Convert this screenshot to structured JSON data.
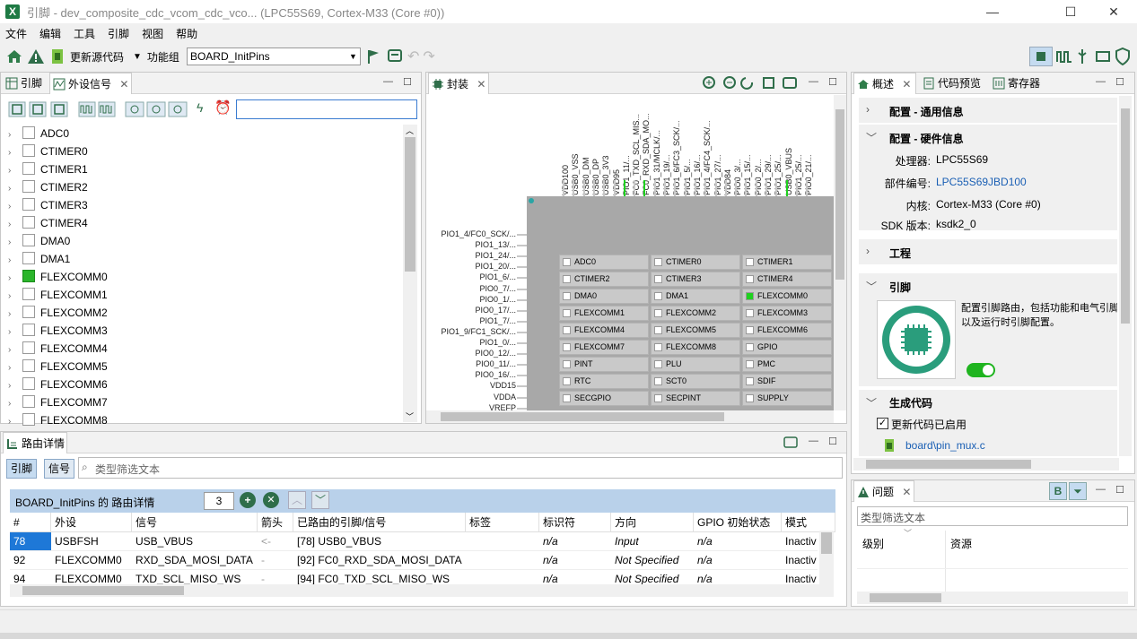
{
  "window": {
    "title": "引脚 - dev_composite_cdc_vcom_cdc_vco... (LPC55S69, Cortex-M33 (Core #0))",
    "minimize": "—",
    "maximize": "☐",
    "close": "✕"
  },
  "menu": [
    "文件",
    "编辑",
    "工具",
    "引脚",
    "视图",
    "帮助"
  ],
  "toolbar": {
    "update_code": "更新源代码",
    "function_group_label": "功能组",
    "function_group_value": "BOARD_InitPins"
  },
  "left_panel": {
    "tabs": [
      "引脚",
      "外设信号"
    ],
    "search_value": "",
    "items": [
      {
        "label": "ADC0",
        "checked": false
      },
      {
        "label": "CTIMER0",
        "checked": false
      },
      {
        "label": "CTIMER1",
        "checked": false
      },
      {
        "label": "CTIMER2",
        "checked": false
      },
      {
        "label": "CTIMER3",
        "checked": false
      },
      {
        "label": "CTIMER4",
        "checked": false
      },
      {
        "label": "DMA0",
        "checked": false
      },
      {
        "label": "DMA1",
        "checked": false
      },
      {
        "label": "FLEXCOMM0",
        "checked": true
      },
      {
        "label": "FLEXCOMM1",
        "checked": false
      },
      {
        "label": "FLEXCOMM2",
        "checked": false
      },
      {
        "label": "FLEXCOMM3",
        "checked": false
      },
      {
        "label": "FLEXCOMM4",
        "checked": false
      },
      {
        "label": "FLEXCOMM5",
        "checked": false
      },
      {
        "label": "FLEXCOMM6",
        "checked": false
      },
      {
        "label": "FLEXCOMM7",
        "checked": false
      },
      {
        "label": "FLEXCOMM8",
        "checked": false
      }
    ]
  },
  "package_panel": {
    "tab": "封装",
    "top_pins": [
      "VDD100",
      "USB0_VSS",
      "USB0_DM",
      "USB0_DP",
      "USB0_3V3",
      "VDD95",
      "PIO1_11/...",
      "FC0_TXD_SCL_MIS...",
      "FC0_RXD_SDA_MO...",
      "PIO1_31/MCLK/...",
      "PIO1_19/...",
      "PIO1_6/FC3_SCK/...",
      "PIO1_5/...",
      "PIO1_16/...",
      "PIO1_4/FC4_SCK/...",
      "PIO1_27/...",
      "VDD84",
      "PIO0_3/...",
      "PIO1_15/...",
      "PIO0_2/...",
      "PIO1_29/...",
      "PIO1_25/...",
      "USB0_VBUS",
      "PIO1_25/...",
      "PIO0_21/..."
    ],
    "left_pins": [
      "PIO1_4/FC0_SCK/...",
      "PIO1_13/...",
      "PIO1_24/...",
      "PIO1_20/...",
      "PIO1_6/...",
      "PIO0_7/...",
      "PIO0_1/...",
      "PIO0_17/...",
      "PIO1_7/...",
      "PIO1_9/FC1_SCK/...",
      "PIO1_0/...",
      "PIO0_12/...",
      "PIO0_11/...",
      "PIO0_16/...",
      "VDD15",
      "VDDA",
      "VREFP"
    ],
    "cells": [
      {
        "label": "ADC0",
        "on": false
      },
      {
        "label": "CTIMER0",
        "on": false
      },
      {
        "label": "CTIMER1",
        "on": false
      },
      {
        "label": "CTIMER2",
        "on": false
      },
      {
        "label": "CTIMER3",
        "on": false
      },
      {
        "label": "CTIMER4",
        "on": false
      },
      {
        "label": "DMA0",
        "on": false
      },
      {
        "label": "DMA1",
        "on": false
      },
      {
        "label": "FLEXCOMM0",
        "on": true
      },
      {
        "label": "FLEXCOMM1",
        "on": false
      },
      {
        "label": "FLEXCOMM2",
        "on": false
      },
      {
        "label": "FLEXCOMM3",
        "on": false
      },
      {
        "label": "FLEXCOMM4",
        "on": false
      },
      {
        "label": "FLEXCOMM5",
        "on": false
      },
      {
        "label": "FLEXCOMM6",
        "on": false
      },
      {
        "label": "FLEXCOMM7",
        "on": false
      },
      {
        "label": "FLEXCOMM8",
        "on": false
      },
      {
        "label": "GPIO",
        "on": false
      },
      {
        "label": "PINT",
        "on": false
      },
      {
        "label": "PLU",
        "on": false
      },
      {
        "label": "PMC",
        "on": false
      },
      {
        "label": "RTC",
        "on": false
      },
      {
        "label": "SCT0",
        "on": false
      },
      {
        "label": "SDIF",
        "on": false
      },
      {
        "label": "SECGPIO",
        "on": false
      },
      {
        "label": "SECPINT",
        "on": false
      },
      {
        "label": "SUPPLY",
        "on": false
      }
    ]
  },
  "overview_panel": {
    "tabs": [
      "概述",
      "代码预览",
      "寄存器"
    ],
    "config_general": "配置 - 通用信息",
    "config_hw": "配置 - 硬件信息",
    "processor_label": "处理器:",
    "processor_value": "LPC55S69",
    "part_label": "部件编号:",
    "part_value": "LPC55S69JBD100",
    "core_label": "内核:",
    "core_value": "Cortex-M33 (Core #0)",
    "sdk_label": "SDK 版本:",
    "sdk_value": "ksdk2_0",
    "project": "工程",
    "pins": "引脚",
    "pins_desc_1": "配置引脚路由，包括功能和电气引脚",
    "pins_desc_2": "以及运行时引脚配置。",
    "generate_code": "生成代码",
    "update_enabled": "更新代码已启用",
    "file_link": "board\\pin_mux.c"
  },
  "routing_panel": {
    "tab": "路由详情",
    "btn_pins": "引脚",
    "btn_signals": "信号",
    "filter_placeholder": "类型筛选文本",
    "title": "BOARD_InitPins 的 路由详情",
    "count": "3",
    "columns": [
      "#",
      "外设",
      "信号",
      "箭头",
      "已路由的引脚/信号",
      "标签",
      "标识符",
      "方向",
      "GPIO 初始状态",
      "模式"
    ],
    "rows": [
      [
        "78",
        "USBFSH",
        "USB_VBUS",
        "<-",
        "[78] USB0_VBUS",
        "",
        "n/a",
        "Input",
        "n/a",
        "Inactiv"
      ],
      [
        "92",
        "FLEXCOMM0",
        "RXD_SDA_MOSI_DATA",
        "-",
        "[92] FC0_RXD_SDA_MOSI_DATA",
        "",
        "n/a",
        "Not Specified",
        "n/a",
        "Inactiv"
      ],
      [
        "94",
        "FLEXCOMM0",
        "TXD_SCL_MISO_WS",
        "-",
        "[94] FC0_TXD_SCL_MISO_WS",
        "",
        "n/a",
        "Not Specified",
        "n/a",
        "Inactiv"
      ]
    ]
  },
  "problems_panel": {
    "tab": "问题",
    "filter_placeholder": "类型筛选文本",
    "col_level": "级别",
    "col_resource": "资源"
  }
}
